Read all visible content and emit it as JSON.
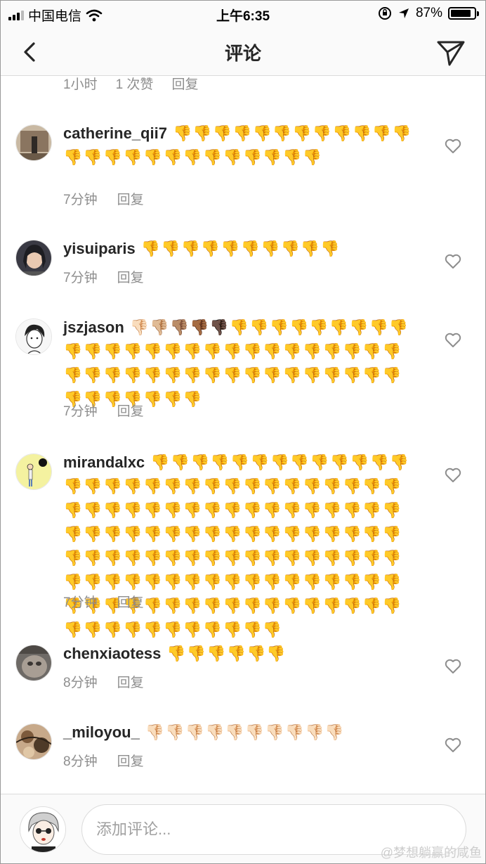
{
  "status": {
    "carrier": "中国电信",
    "time": "上午6:35",
    "battery": "87%",
    "battery_level": 0.87
  },
  "nav": {
    "title": "评论"
  },
  "partial": {
    "time": "1小时",
    "likes": "1 次赞",
    "reply": "回复"
  },
  "comments": [
    {
      "username": "catherine_qii7",
      "text": "👎👎👎👎👎👎👎👎👎👎👎👎👎👎👎👎👎👎👎👎👎👎👎👎👎",
      "time": "7分钟",
      "reply": "回复"
    },
    {
      "username": "yisuiparis",
      "text": "👎👎👎👎👎👎👎👎👎👎",
      "time": "7分钟",
      "reply": "回复"
    },
    {
      "username": "jszjason",
      "text": "👎🏻👎🏼👎🏽👎🏾👎🏿👎👎👎👎👎👎👎👎👎👎👎👎👎👎👎👎👎👎👎👎👎👎👎👎👎👎👎👎👎👎👎👎👎👎👎👎👎👎👎👎👎👎👎👎👎👎👎👎👎👎",
      "time": "7分钟",
      "reply": "回复"
    },
    {
      "username": "mirandalxc",
      "text": "👎👎👎👎👎👎👎👎👎👎👎👎👎👎👎👎👎👎👎👎👎👎👎👎👎👎👎👎👎👎👎👎👎👎👎👎👎👎👎👎👎👎👎👎👎👎👎👎👎👎👎👎👎👎👎👎👎👎👎👎👎👎👎👎👎👎👎👎👎👎👎👎👎👎👎👎👎👎👎👎👎👎👎👎👎👎👎👎👎👎👎👎👎👎👎👎👎👎👎👎👎👎👎👎👎👎👎👎👎👎👎👎👎👎👎👎👎👎👎👎👎👎👎👎👎👎",
      "time": "7分钟",
      "reply": "回复"
    },
    {
      "username": "chenxiaotess",
      "text": "👎👎👎👎👎👎",
      "time": "8分钟",
      "reply": "回复"
    },
    {
      "username": "_miloyou_",
      "text": "👎🏻👎🏻👎🏻👎🏻👎🏻👎🏻👎🏻👎🏻👎🏻👎🏻",
      "time": "8分钟",
      "reply": "回复"
    }
  ],
  "input": {
    "placeholder": "添加评论..."
  },
  "watermark": "@梦想躺赢的咸鱼",
  "colors": {
    "text": "#262626",
    "meta": "#8e8e8e",
    "bar": "#fafafa",
    "border": "#dbdbdb"
  }
}
